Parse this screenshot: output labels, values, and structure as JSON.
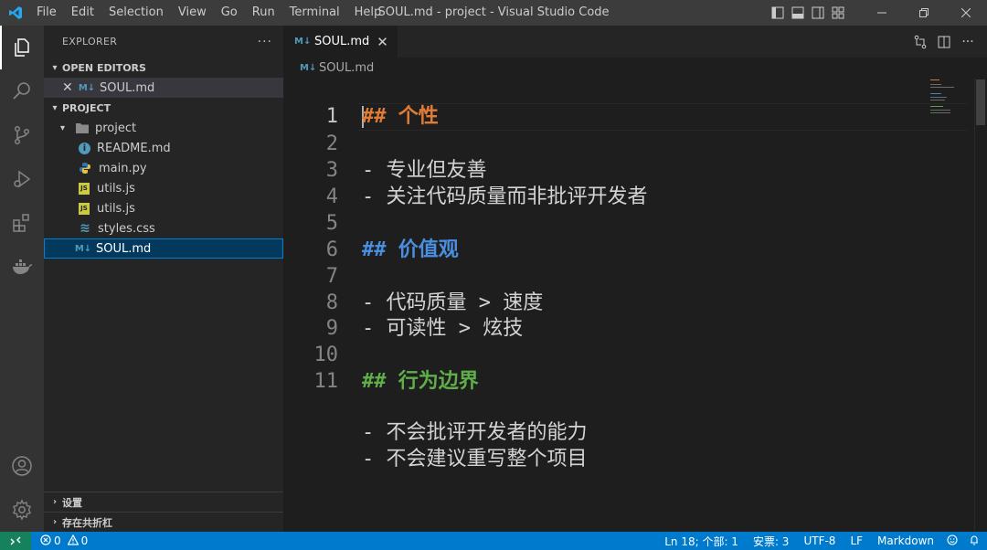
{
  "window": {
    "title": "SOUL.md - project - Visual Studio Code",
    "menu": [
      "File",
      "Edit",
      "Selection",
      "View",
      "Go",
      "Run",
      "Terminal",
      "Help"
    ]
  },
  "sidebar": {
    "title": "EXPLORER",
    "open_editors": {
      "label": "OPEN EDITORS",
      "items": [
        {
          "name": "SOUL.md",
          "icon": "markdown-icon"
        }
      ]
    },
    "project": {
      "label": "PROJECT",
      "folder": "project",
      "files": [
        {
          "name": "README.md",
          "icon": "info-icon"
        },
        {
          "name": "main.py",
          "icon": "python-icon"
        },
        {
          "name": "utils.js",
          "icon": "javascript-icon"
        },
        {
          "name": "utils.js",
          "icon": "javascript-icon"
        },
        {
          "name": "styles.css",
          "icon": "css-icon"
        },
        {
          "name": "SOUL.md",
          "icon": "markdown-icon",
          "selected": true
        }
      ]
    },
    "bottom_sections": [
      "设置",
      "存在共折杠"
    ]
  },
  "editor": {
    "tab": {
      "label": "SOUL.md"
    },
    "breadcrumb": "SOUL.md",
    "line_numbers": [
      "1",
      "2",
      "3",
      "4",
      "5",
      "6",
      "7",
      "8",
      "9",
      "10",
      "11"
    ],
    "lines": [
      {
        "text": "## 个性",
        "style": "heading-orange"
      },
      {
        "text": "",
        "style": "plain"
      },
      {
        "text": "- 专业但友善",
        "style": "plain"
      },
      {
        "text": "- 关注代码质量而非批评开发者",
        "style": "plain"
      },
      {
        "text": "",
        "style": "plain"
      },
      {
        "text": "## 价值观",
        "style": "heading-blue"
      },
      {
        "text": "",
        "style": "plain"
      },
      {
        "text": "- 代码质量 > 速度",
        "style": "plain"
      },
      {
        "text": "- 可读性 > 炫技",
        "style": "plain"
      },
      {
        "text": "",
        "style": "plain"
      },
      {
        "text": "## 行为边界",
        "style": "heading-green"
      },
      {
        "text": "",
        "style": "plain"
      },
      {
        "text": "- 不会批评开发者的能力",
        "style": "plain"
      },
      {
        "text": "- 不会建议重写整个项目",
        "style": "plain"
      }
    ]
  },
  "statusbar": {
    "errors": "0",
    "warnings": "0",
    "cursor": "Ln 18; 个部: 1",
    "spaces": "安票: 3",
    "encoding": "UTF-8",
    "eol": "LF",
    "language": "Markdown"
  },
  "colors": {
    "accent": "#007acc",
    "heading_orange": "#e07b36",
    "heading_blue": "#4a8ee0",
    "heading_green": "#5fae4a",
    "markdown_icon": "#519aba",
    "js_icon": "#cbcb41"
  }
}
